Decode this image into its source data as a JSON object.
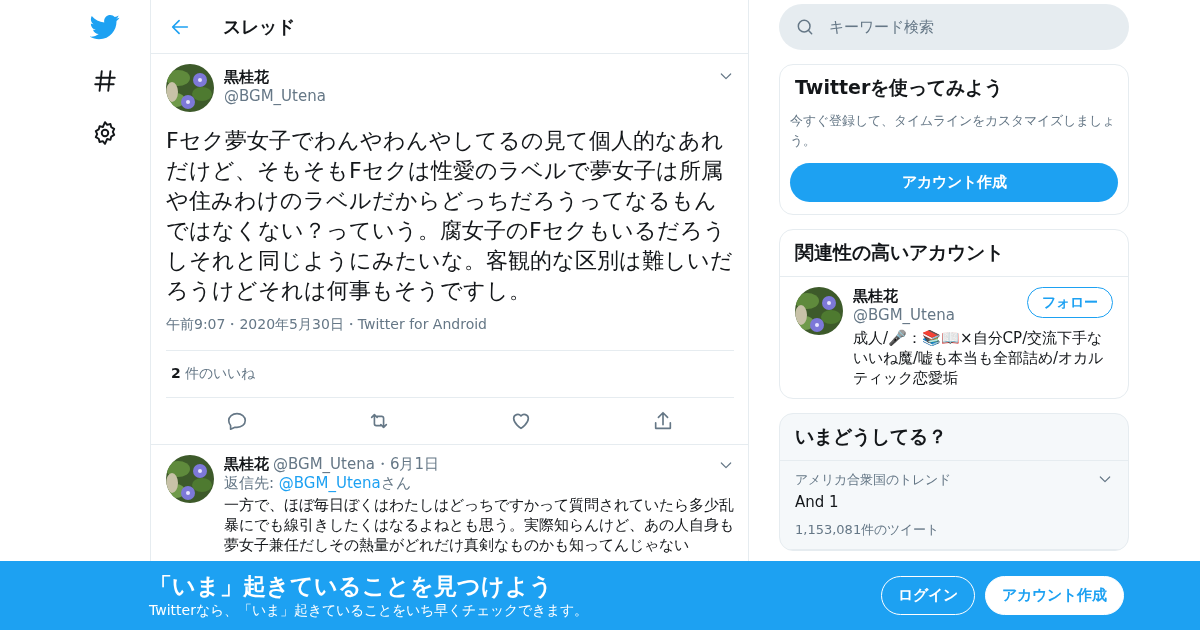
{
  "header": {
    "title": "スレッド"
  },
  "tweet": {
    "name": "黒桂花",
    "handle": "@BGM_Utena",
    "text": "Fセク夢女子でわんやわんやしてるの見て個人的なあれだけど、そもそもFセクは性愛のラベルで夢女子は所属や住みわけのラベルだからどっちだろうってなるもんではなくない？っていう。腐女子のFセクもいるだろうしそれと同じようにみたいな。客観的な区別は難しいだろうけどそれは何事もそうですし。",
    "meta": "午前9:07・2020年5月30日・Twitter for Android",
    "likes_count": "2",
    "likes_label": "件のいいね"
  },
  "reply": {
    "name": "黒桂花",
    "handle_date": "@BGM_Utena・6月1日",
    "reply_label": "返信先:",
    "reply_handle": "@BGM_Utena",
    "reply_suffix": "さん",
    "text": "一方で、ほぼ毎日ぼくはわたしはどっちですかって質問されていたら多少乱暴にでも線引きしたくはなるよねとも思う。実際知らんけど、あの人自身も夢女子兼任だしその熱量がどれだけ真剣なものかも知ってんじゃない"
  },
  "search": {
    "placeholder": "キーワード検索"
  },
  "signup_card": {
    "title": "Twitterを使ってみよう",
    "text": "今すぐ登録して、タイムラインをカスタマイズしましょう。",
    "button": "アカウント作成"
  },
  "related": {
    "title": "関連性の高いアカウント",
    "accounts": [
      {
        "name": "黒桂花",
        "handle": "@BGM_Utena",
        "button": "フォロー",
        "bio": "成人/🎤：📚📖×自分CP/交流下手ないいね魔/嘘も本当も全部詰め/オカルティック恋愛垢"
      }
    ]
  },
  "trends": {
    "title": "いまどうしてる？",
    "items": [
      {
        "context": "アメリカ合衆国のトレンド",
        "name": "And 1",
        "count": "1,153,081件のツイート"
      }
    ]
  },
  "banner": {
    "title": "「いま」起きていることを見つけよう",
    "subtitle": "Twitterなら、「いま」起きていることをいち早くチェックできます。",
    "buttons": [
      {
        "kind": "outline",
        "label": "ログイン"
      },
      {
        "kind": "filled",
        "label": "アカウント作成"
      }
    ]
  }
}
